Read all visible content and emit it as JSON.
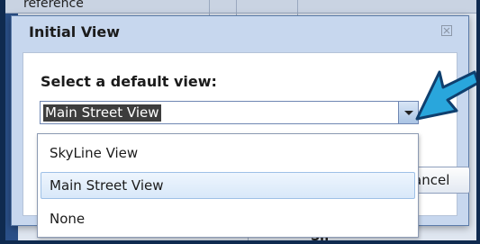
{
  "background": {
    "top_text": "reference",
    "bottom_text": "Sh"
  },
  "dialog": {
    "title": "Initial View",
    "close_glyph": "☒",
    "prompt": "Select a default view:",
    "selected_value": "Main Street View",
    "cancel_label": "Cancel"
  },
  "dropdown": {
    "options": [
      {
        "label": "SkyLine View",
        "selected": false
      },
      {
        "label": "Main Street View",
        "selected": true
      },
      {
        "label": "None",
        "selected": false
      }
    ]
  },
  "colors": {
    "callout_arrow": "#29a6dc",
    "frame": "#0f2a4f",
    "dialog_bg": "#c7d7ee"
  },
  "icons": {
    "close": "close-icon",
    "dropdown_arrow": "chevron-down-icon",
    "callout": "arrow-pointer-icon"
  }
}
